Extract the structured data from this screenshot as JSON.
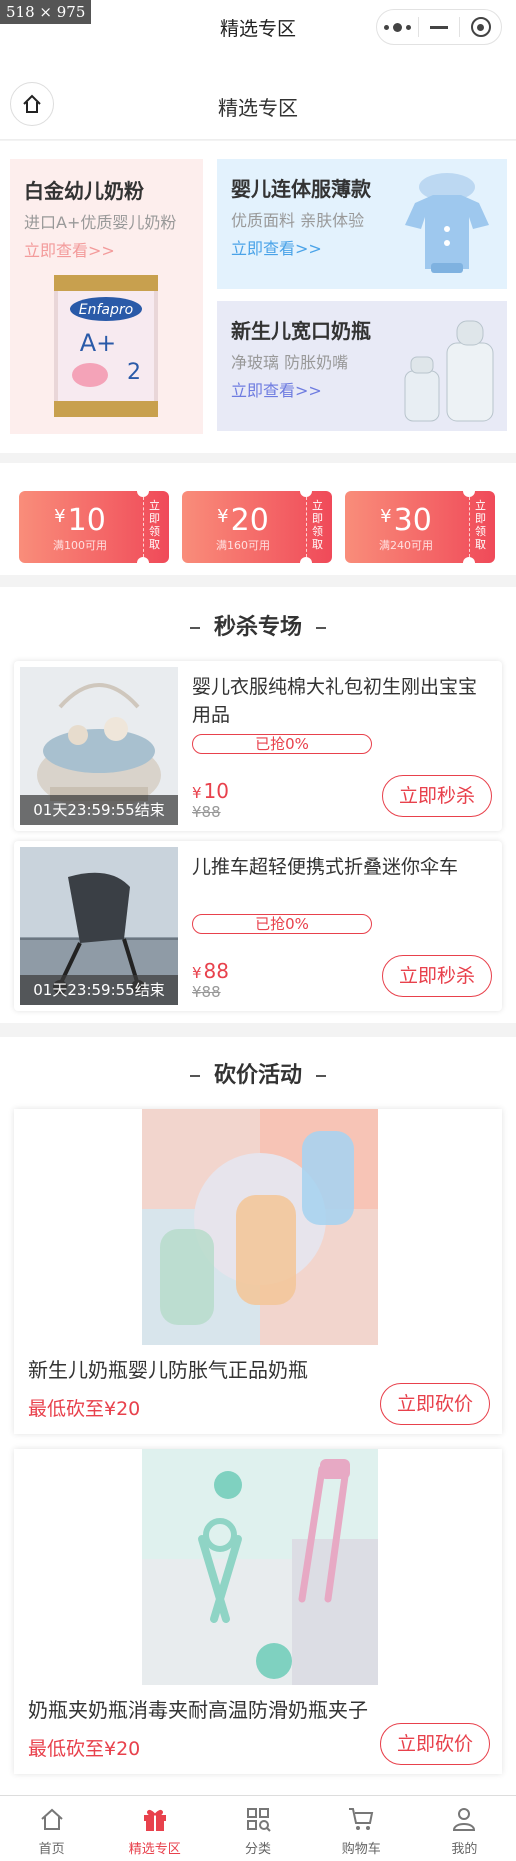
{
  "screenshot_dims": "518 × 975",
  "status_bar": {
    "title": "精选专区"
  },
  "nav": {
    "title": "精选专区"
  },
  "promos": {
    "left": {
      "title": "白金幼儿奶粉",
      "subtitle": "进口A+优质婴儿奶粉",
      "link": "立即查看>>",
      "can_brand": "Enfapro",
      "can_stage": "A+",
      "can_number": "2"
    },
    "right_top": {
      "title": "婴儿连体服薄款",
      "subtitle": "优质面料 亲肤体验",
      "link": "立即查看>>"
    },
    "right_bottom": {
      "title": "新生儿宽口奶瓶",
      "subtitle": "净玻璃 防胀奶嘴",
      "link": "立即查看>>"
    }
  },
  "coupons": [
    {
      "currency": "¥",
      "amount": "10",
      "condition": "满100可用",
      "action": "立即领取"
    },
    {
      "currency": "¥",
      "amount": "20",
      "condition": "满160可用",
      "action": "立即领取"
    },
    {
      "currency": "¥",
      "amount": "30",
      "condition": "满240可用",
      "action": "立即领取"
    }
  ],
  "flash_sale": {
    "title": "秒杀专场",
    "items": [
      {
        "name": "婴儿衣服纯棉大礼包初生刚出宝宝用品",
        "timer": "01天23:59:55结束",
        "progress": "已抢0%",
        "progress_value": 0,
        "currency": "¥",
        "price": "10",
        "original_price": "¥88",
        "button": "立即秒杀"
      },
      {
        "name": "儿推车超轻便携式折叠迷你伞车",
        "timer": "01天23:59:55结束",
        "progress": "已抢0%",
        "progress_value": 0,
        "currency": "¥",
        "price": "88",
        "original_price": "¥88",
        "button": "立即秒杀"
      }
    ]
  },
  "bargain": {
    "title": "砍价活动",
    "items": [
      {
        "name": "新生儿奶瓶婴儿防胀气正品奶瓶",
        "price_text": "最低砍至¥20",
        "button": "立即砍价"
      },
      {
        "name": "奶瓶夹奶瓶消毒夹耐高温防滑奶瓶夹子",
        "price_text": "最低砍至¥20",
        "button": "立即砍价"
      }
    ]
  },
  "tabbar": {
    "items": [
      {
        "label": "首页",
        "icon": "home-icon",
        "active": false
      },
      {
        "label": "精选专区",
        "icon": "gift-icon",
        "active": true
      },
      {
        "label": "分类",
        "icon": "category-icon",
        "active": false
      },
      {
        "label": "购物车",
        "icon": "cart-icon",
        "active": false
      },
      {
        "label": "我的",
        "icon": "user-icon",
        "active": false
      }
    ]
  },
  "colors": {
    "accent": "#e8414c",
    "link_pink": "#f39b9b",
    "link_blue": "#4aa3e8",
    "link_purple": "#6e7ce0"
  }
}
